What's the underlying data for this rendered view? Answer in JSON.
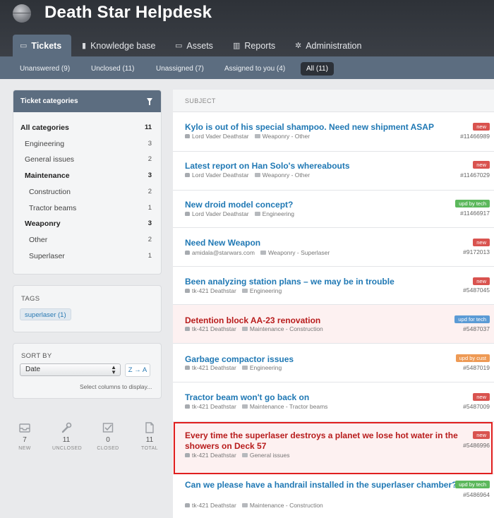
{
  "app": {
    "title": "Death Star Helpdesk",
    "logo_icon": "death-star-logo-icon"
  },
  "main_tabs": [
    {
      "label": "Tickets",
      "icon": "inbox-icon",
      "active": true
    },
    {
      "label": "Knowledge base",
      "icon": "book-icon"
    },
    {
      "label": "Assets",
      "icon": "laptop-icon"
    },
    {
      "label": "Reports",
      "icon": "bar-chart-icon"
    },
    {
      "label": "Administration",
      "icon": "gear-icon"
    }
  ],
  "sub_tabs": [
    {
      "label": "Unanswered (9)"
    },
    {
      "label": "Unclosed (11)"
    },
    {
      "label": "Unassigned (7)"
    },
    {
      "label": "Assigned to you (4)"
    },
    {
      "label": "All (11)",
      "active": true
    }
  ],
  "categories": {
    "title": "Ticket categories",
    "items": [
      {
        "label": "All categories",
        "count": "11",
        "bold": true
      },
      {
        "label": "Engineering",
        "count": "3"
      },
      {
        "label": "General issues",
        "count": "2"
      },
      {
        "label": "Maintenance",
        "count": "3",
        "bold": true
      },
      {
        "label": "Construction",
        "count": "2"
      },
      {
        "label": "Tractor beams",
        "count": "1"
      },
      {
        "label": "Weaponry",
        "count": "3",
        "bold": true
      },
      {
        "label": "Other",
        "count": "2"
      },
      {
        "label": "Superlaser",
        "count": "1"
      }
    ]
  },
  "tags": {
    "title": "TAGS",
    "items": [
      {
        "label": "superlaser (1)"
      }
    ]
  },
  "sort": {
    "title": "SORT BY",
    "selected": "Date",
    "direction_label": "Z → A",
    "select_columns": "Select columns to display..."
  },
  "stats": [
    {
      "value": "7",
      "label": "NEW",
      "icon": "inbox-icon"
    },
    {
      "value": "11",
      "label": "UNCLOSED",
      "icon": "wrench-icon"
    },
    {
      "value": "0",
      "label": "CLOSED",
      "icon": "checkbox-icon"
    },
    {
      "value": "11",
      "label": "TOTAL",
      "icon": "document-icon"
    }
  ],
  "list": {
    "column_header": "SUBJECT",
    "tickets": [
      {
        "subject": "Kylo is out of his special shampoo. Need new shipment ASAP",
        "author": "Lord Vader Deathstar",
        "category": "Weaponry - Other",
        "badge": "new",
        "id": "#11466989"
      },
      {
        "subject": "Latest report on Han Solo's whereabouts",
        "author": "Lord Vader Deathstar",
        "category": "Weaponry - Other",
        "badge": "new",
        "id": "#11467029"
      },
      {
        "subject": "New droid model concept?",
        "author": "Lord Vader Deathstar",
        "category": "Engineering",
        "badge": "upd by tech",
        "id": "#11466917"
      },
      {
        "subject": "Need New Weapon",
        "author": "amidala@starwars.com",
        "category": "Weaponry - Superlaser",
        "badge": "new",
        "id": "#9172013"
      },
      {
        "subject": "Been analyzing station plans – we may be in trouble",
        "author": "tk-421 Deathstar",
        "category": "Engineering",
        "badge": "new",
        "id": "#5487045"
      },
      {
        "subject": "Detention block AA-23 renovation",
        "author": "tk-421 Deathstar",
        "category": "Maintenance - Construction",
        "badge": "upd for tech",
        "id": "#5487037"
      },
      {
        "subject": "Garbage compactor issues",
        "author": "tk-421 Deathstar",
        "category": "Engineering",
        "badge": "upd by cust",
        "id": "#5487019"
      },
      {
        "subject": "Tractor beam won't go back on",
        "author": "tk-421 Deathstar",
        "category": "Maintenance - Tractor beams",
        "badge": "new",
        "id": "#5487009"
      },
      {
        "subject": "Every time the superlaser destroys a planet we lose hot water in the showers on Deck 57",
        "author": "tk-421 Deathstar",
        "category": "General issues",
        "badge": "new",
        "id": "#5486996"
      },
      {
        "subject": "Can we please have a handrail installed in the superlaser chamber?",
        "author": "tk-421 Deathstar",
        "category": "Maintenance - Construction",
        "badge": "upd by tech",
        "id": "#5486964"
      }
    ]
  },
  "colors": {
    "header": "#2e3238",
    "accent_bar": "#5c6d80",
    "link": "#1f78b4",
    "urgent": "#b81c1c",
    "highlight": "#e01f1f"
  }
}
